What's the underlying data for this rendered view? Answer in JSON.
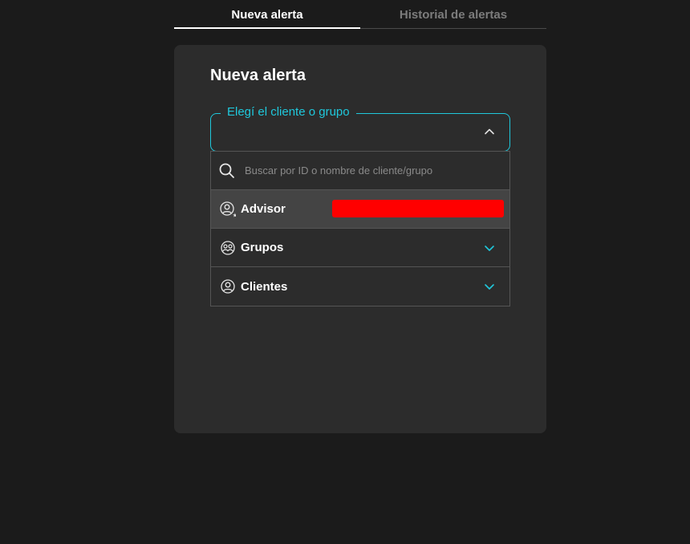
{
  "tabs": [
    {
      "label": "Nueva alerta",
      "active": true
    },
    {
      "label": "Historial de alertas",
      "active": false
    }
  ],
  "card": {
    "title": "Nueva alerta"
  },
  "selector": {
    "label": "Elegí el cliente o grupo",
    "value": "",
    "expanded": true
  },
  "dropdown": {
    "search_placeholder": "Buscar por ID o nombre de cliente/grupo",
    "options": [
      {
        "label": "Advisor",
        "icon": "user-star-icon",
        "highlighted": true,
        "redacted": true
      },
      {
        "label": "Grupos",
        "icon": "users-group-icon",
        "expandable": true
      },
      {
        "label": "Clientes",
        "icon": "user-icon",
        "expandable": true
      }
    ]
  },
  "colors": {
    "accent": "#1fc8dc",
    "background": "#1b1b1b",
    "card": "#2c2c2c",
    "highlight": "#444444",
    "redaction": "#ff0000"
  }
}
